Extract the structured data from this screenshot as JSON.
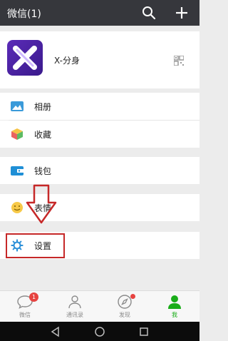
{
  "header": {
    "title": "微信(1)",
    "icons": [
      "search-icon",
      "plus-icon"
    ]
  },
  "profile": {
    "name": "X-分身",
    "icons": [
      "app-logo",
      "qr-code-icon"
    ]
  },
  "menu": {
    "album": {
      "label": "相册",
      "icon": "album-icon"
    },
    "favorites": {
      "label": "收藏",
      "icon": "favorites-cube-icon"
    },
    "wallet": {
      "label": "钱包",
      "icon": "wallet-icon"
    },
    "stickers": {
      "label": "表情",
      "icon": "smiley-icon"
    },
    "settings": {
      "label": "设置",
      "icon": "gear-icon"
    }
  },
  "tabbar": {
    "tabs": [
      {
        "label": "微信",
        "icon": "chat-bubble-icon",
        "badge": "1"
      },
      {
        "label": "通讯录",
        "icon": "contacts-icon"
      },
      {
        "label": "发现",
        "icon": "compass-icon",
        "has_dot": true
      },
      {
        "label": "我",
        "icon": "me-icon",
        "active": true
      }
    ],
    "active_color": "#1aad19",
    "inactive_color": "#8b8b8b"
  },
  "annotation": {
    "color": "#c62828",
    "arrow_color": "#c62828"
  },
  "colors": {
    "titlebar": "#36373c",
    "background": "#ececec",
    "badge": "#e64340"
  },
  "navbar": {
    "icons": [
      "back-icon",
      "home-icon",
      "recents-icon"
    ]
  }
}
